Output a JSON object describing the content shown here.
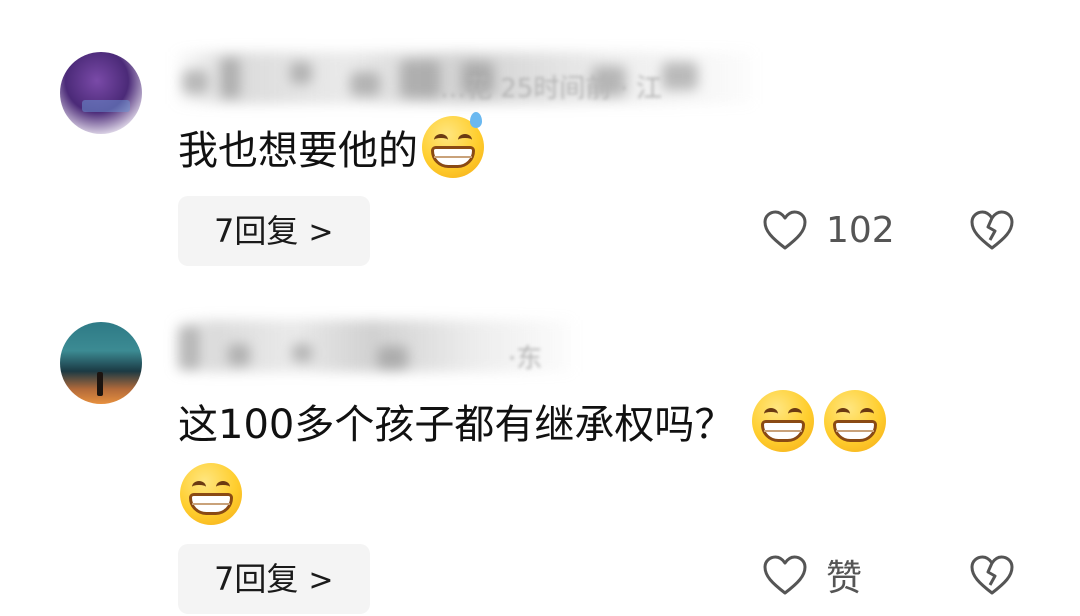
{
  "comments": [
    {
      "text": "我也想要他的",
      "emojis": [
        "grin-sweat-emoji"
      ],
      "reply_label": "7回复",
      "reply_chevron": ">",
      "likes": "102",
      "name_residue": "…花 25时间前 · 江"
    },
    {
      "text": "这100多个孩子都有继承权吗？",
      "emojis": [
        "grin-emoji",
        "grin-emoji",
        "grin-emoji"
      ],
      "reply_label": "7回复",
      "reply_chevron": ">",
      "likes": "赞",
      "name_residue": "·东"
    }
  ],
  "colors": {
    "text": "#111111",
    "meta": "#555555",
    "reply_bg": "#f4f4f4",
    "emoji": "#ffce2e"
  }
}
